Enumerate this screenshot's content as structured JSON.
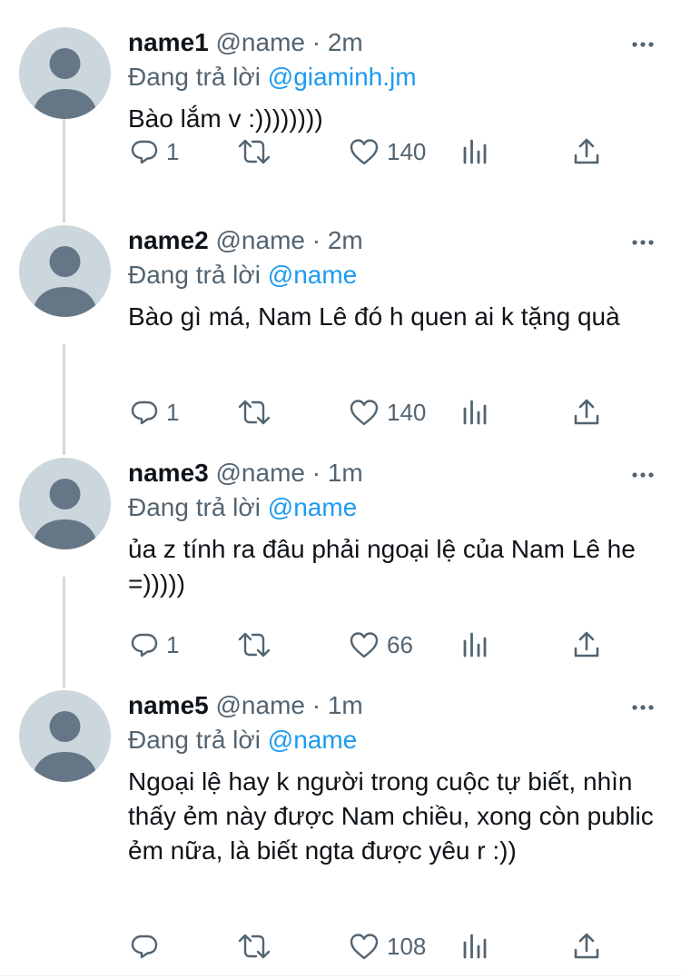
{
  "reply_prefix": "Đang trả lời",
  "tweets": [
    {
      "name": "name1",
      "handle": "@name",
      "dot": "·",
      "time": "2m",
      "reply_to": "@giaminh.jm",
      "text": "Bào lắm v :))))))))",
      "replies": "1",
      "retweets": "",
      "likes": "140"
    },
    {
      "name": "name2",
      "handle": "@name",
      "dot": "·",
      "time": "2m",
      "reply_to": "@name",
      "text": "Bào gì má, Nam Lê đó h quen ai k tặng quà",
      "replies": "1",
      "retweets": "",
      "likes": "140"
    },
    {
      "name": "name3",
      "handle": "@name",
      "dot": "·",
      "time": "1m",
      "reply_to": "@name",
      "text": "ủa z tính ra đâu phải ngoại lệ của Nam Lê he =)))))",
      "replies": "1",
      "retweets": "",
      "likes": "66"
    },
    {
      "name": "name5",
      "handle": "@name",
      "dot": "·",
      "time": "1m",
      "reply_to": "@name",
      "text": "Ngoại lệ hay k người trong cuộc tự biết, nhìn thấy ẻm này được Nam chiều, xong còn public ẻm nữa, là biết ngta được yêu r :))",
      "replies": "",
      "retweets": "",
      "likes": "108"
    }
  ],
  "colors": {
    "link": "#1d9bf0",
    "secondary_text": "#536471",
    "avatar_bg": "#ccd6dd",
    "avatar_fg": "#657786",
    "thread_line": "#cfd9de"
  },
  "icons": [
    "reply-icon",
    "retweet-icon",
    "like-icon",
    "analytics-icon",
    "share-icon",
    "more-icon"
  ]
}
